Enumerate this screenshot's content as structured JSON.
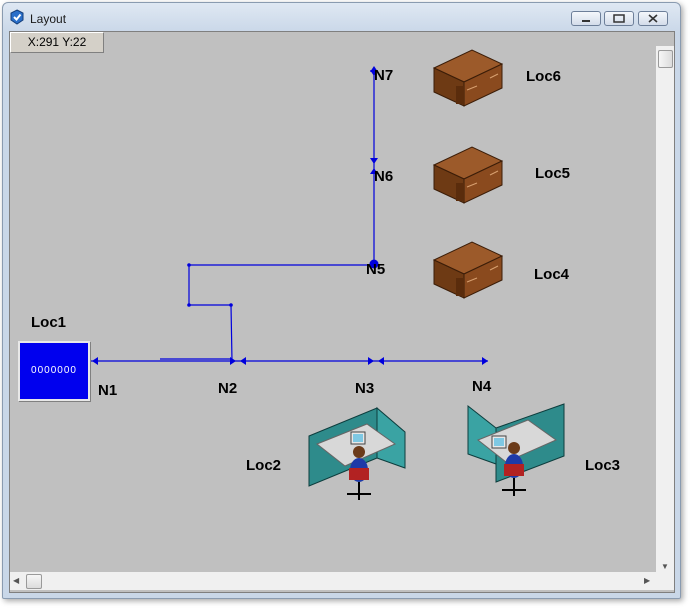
{
  "window": {
    "title": "Layout"
  },
  "status": {
    "coords": "X:291 Y:22"
  },
  "locations": {
    "loc1": {
      "label": "Loc1",
      "display": "0000000"
    },
    "loc2": {
      "label": "Loc2"
    },
    "loc3": {
      "label": "Loc3"
    },
    "loc4": {
      "label": "Loc4"
    },
    "loc5": {
      "label": "Loc5"
    },
    "loc6": {
      "label": "Loc6"
    }
  },
  "nodes": {
    "n1": "N1",
    "n2": "N2",
    "n3": "N3",
    "n4": "N4",
    "n5": "N5",
    "n6": "N6",
    "n7": "N7"
  },
  "colors": {
    "canvas": "#c0c0c0",
    "path": "#0000dd",
    "desk": "#8b4513",
    "cubicle": "#2e8b8b",
    "loc1": "#0000ee"
  },
  "icons": [
    "app-icon",
    "minimize-icon",
    "maximize-icon",
    "close-icon",
    "desk-icon",
    "cubicle-workstation-icon"
  ]
}
